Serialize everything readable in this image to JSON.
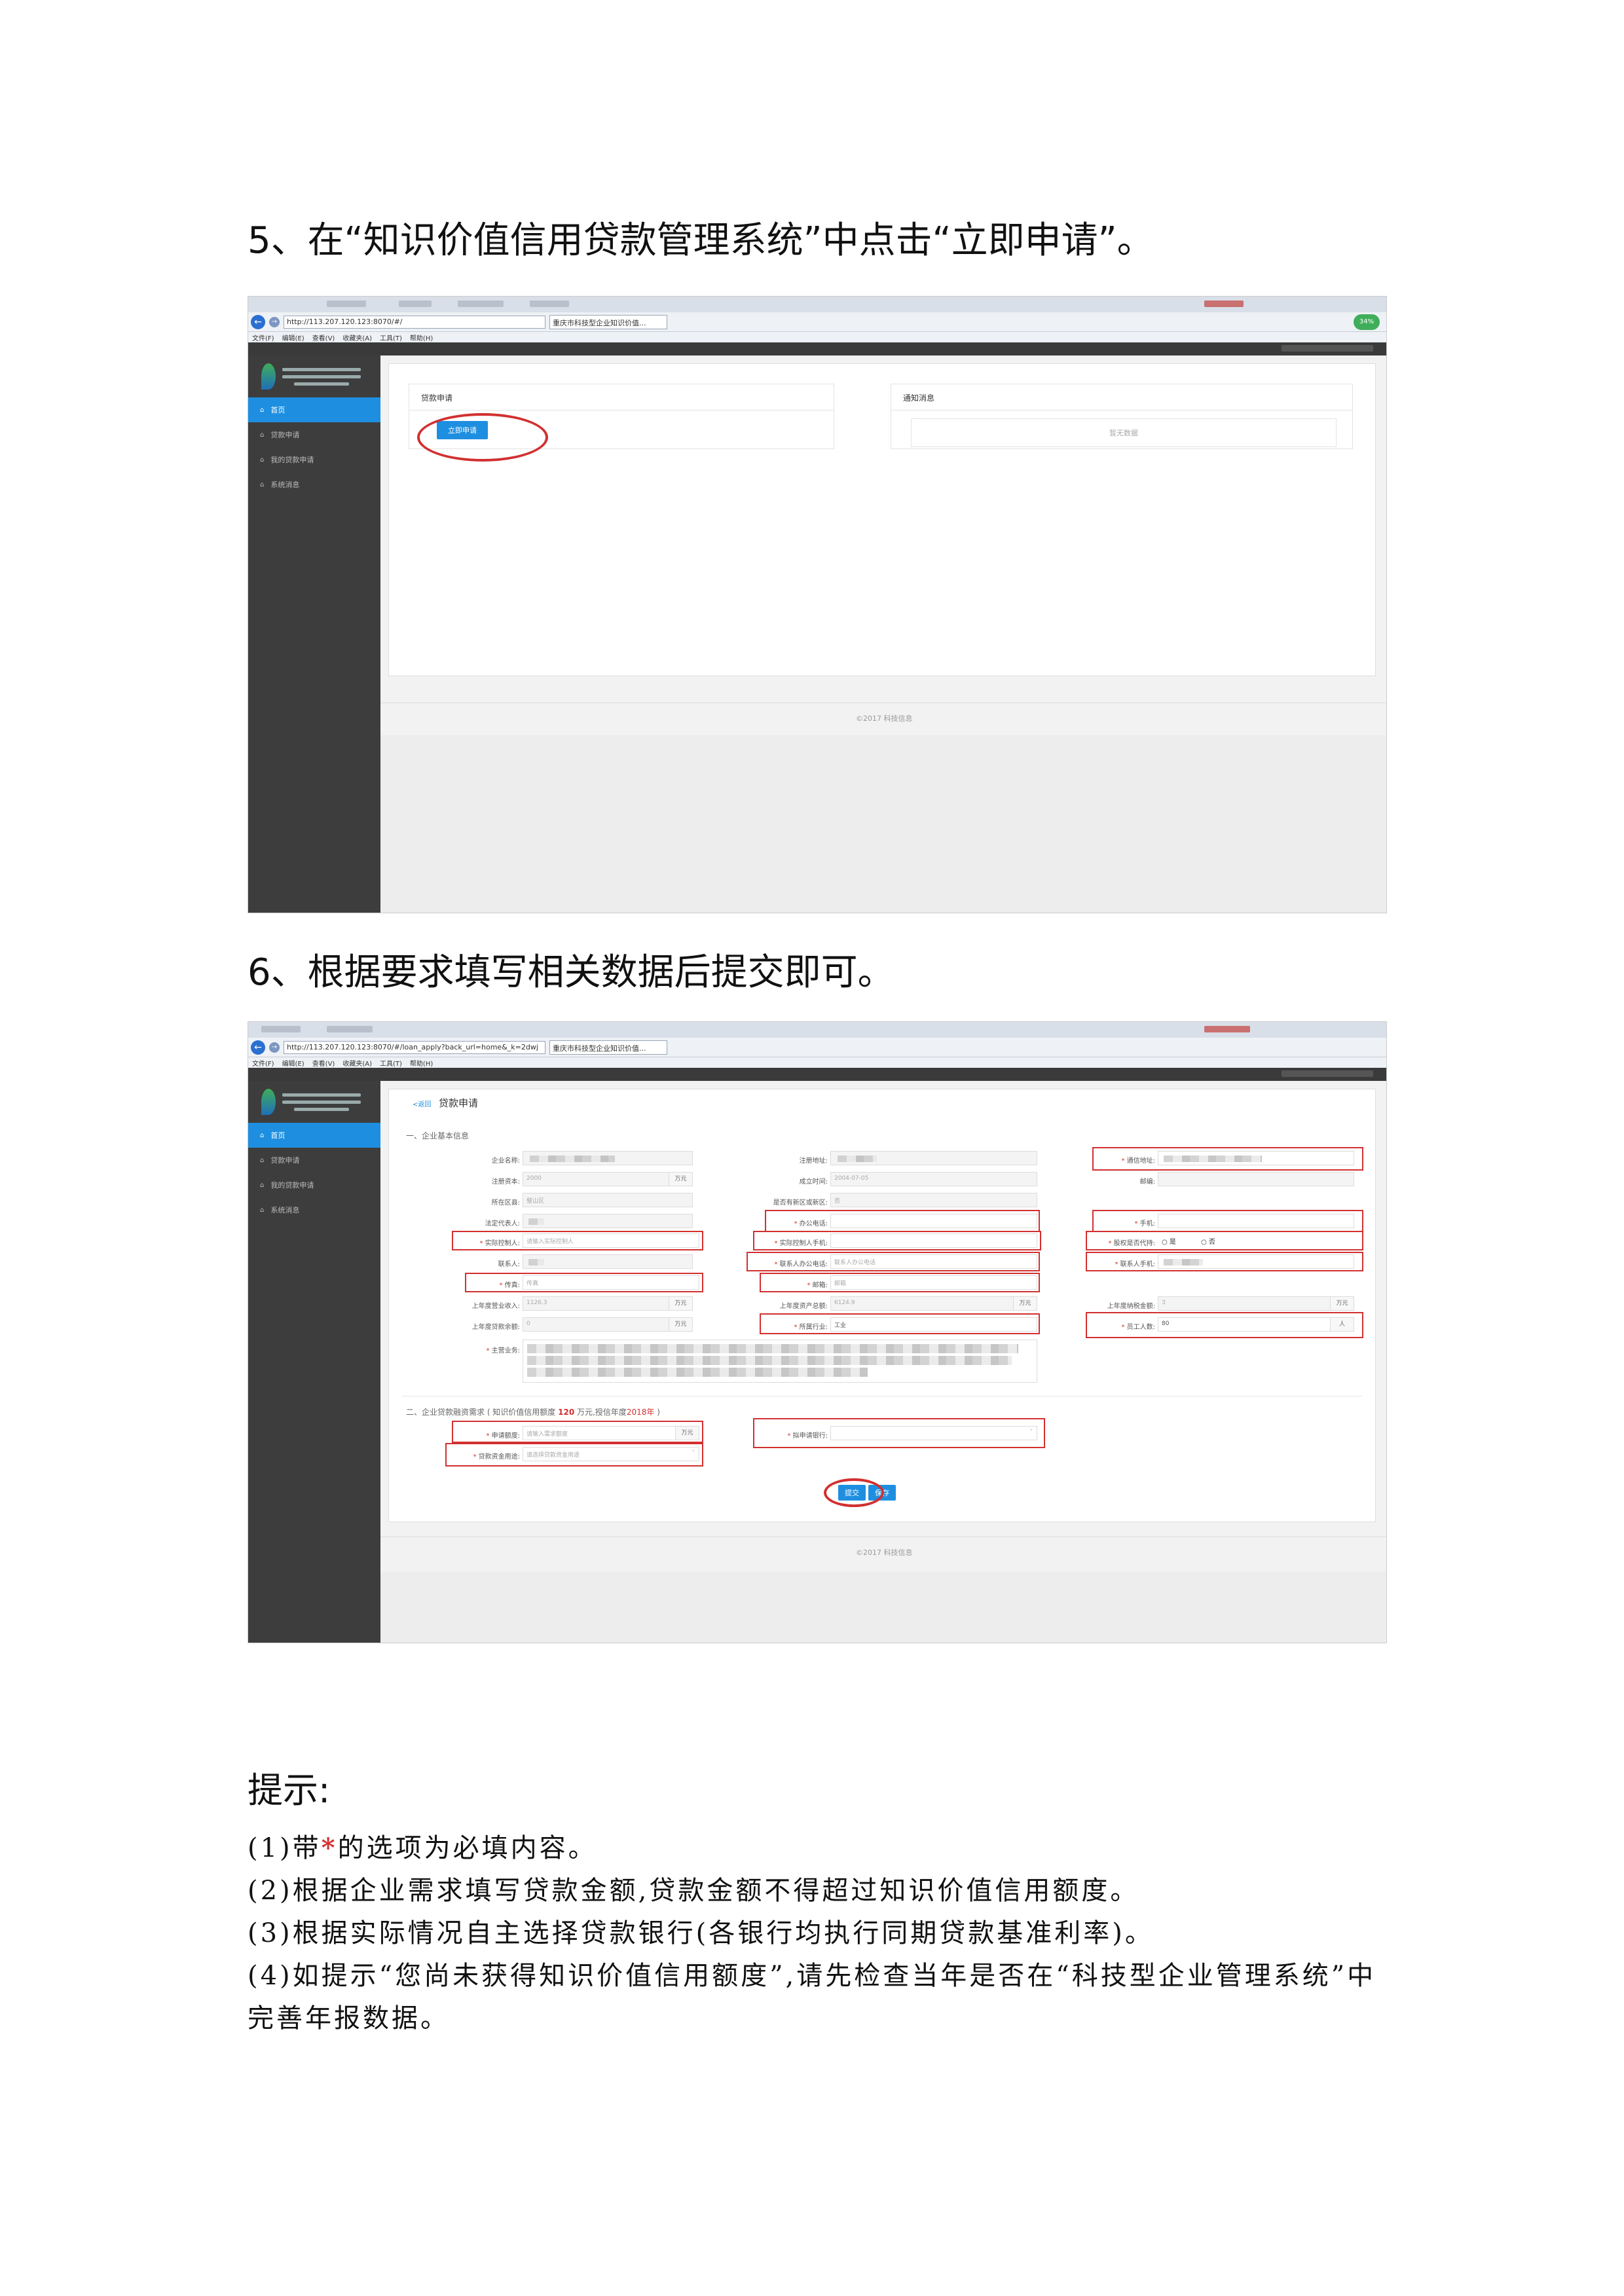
{
  "step5": "5、在“知识价值信用贷款管理系统”中点击“立即申请”。",
  "step6": "6、根据要求填写相关数据后提交即可。",
  "browser1": {
    "back_icon": "arrow-left-icon",
    "address": "http://113.207.120.123:8070/#/",
    "tab": "重庆市科技型企业知识价值...",
    "menu": [
      "文件(F)",
      "编辑(E)",
      "查看(V)",
      "收藏夹(A)",
      "工具(T)",
      "帮助(H)"
    ]
  },
  "browser2": {
    "address": "http://113.207.120.123:8070/#/loan_apply?back_url=home&_k=2dwj",
    "tab": "重庆市科技型企业知识价值...",
    "menu": [
      "文件(F)",
      "编辑(E)",
      "查看(V)",
      "收藏夹(A)",
      "工具(T)",
      "帮助(H)"
    ]
  },
  "sidebar": {
    "items": [
      "首页",
      "贷款申请",
      "我的贷款申请",
      "系统消息"
    ]
  },
  "home": {
    "loan_card_title": "贷款申请",
    "apply_button": "立即申请",
    "notice_card_title": "通知消息",
    "empty_text": "暂无数据",
    "footer": "©2017 科技信息"
  },
  "form": {
    "back_link": "<返回",
    "title": "贷款申请",
    "section1": "一、企业基本信息",
    "fields": {
      "company_name": "企业名称:",
      "reg_address": "注册地址:",
      "mail_address": "通信地址:",
      "reg_capital": "注册资本:",
      "reg_capital_value": "2000",
      "founded": "成立时间:",
      "founded_value": "2004-07-05",
      "postcode": "邮编:",
      "district": "所在区县:",
      "district_value": "璧山区",
      "high_tech_zone": "是否有新区或新区:",
      "high_tech_zone_value": "否",
      "legal_rep": "法定代表人:",
      "office_phone": "办公电话:",
      "mobile": "手机:",
      "controller": "实际控制人:",
      "controller_placeholder": "请输入实际控制人",
      "controller_mobile": "实际控制人手机:",
      "equity_pledge": "股权是否代持:",
      "equity_yes": "是",
      "equity_no": "否",
      "contact": "联系人:",
      "contact_office_phone": "联系人办公电话:",
      "contact_office_placeholder": "联系人办公电话",
      "contact_mobile": "联系人手机:",
      "fax": "传真:",
      "fax_value": "传真",
      "email": "邮箱:",
      "email_value": "邮箱",
      "last_revenue": "上年度营业收入:",
      "last_revenue_value": "1126.3",
      "last_assets": "上年度资产总额:",
      "last_assets_value": "6124.9",
      "last_tax": "上年度纳税金额:",
      "last_tax_value": "3",
      "last_loan": "上年度贷款余额:",
      "last_loan_value": "0",
      "industry": "所属行业:",
      "industry_value": "工业",
      "employees": "员工人数:",
      "employees_value": "80",
      "main_business": "主营业务:",
      "unit_wan": "万元",
      "unit_ren": "人"
    },
    "section2": "二、企业贷款融资需求 ( 知识价值信用额度",
    "section2_amount": "120",
    "section2_rest": "万元,授信年度",
    "section2_year": "2018年",
    "section2_close": " )",
    "apply_amount": "申请额度:",
    "apply_amount_placeholder": "请输入需求额度",
    "bank": "拟申请银行:",
    "purpose": "贷款资金用途:",
    "purpose_placeholder": "请选择贷款资金用途",
    "submit": "提交",
    "save": "保存",
    "footer": "©2017 科技信息"
  },
  "tips": {
    "heading": "提示:",
    "item1_prefix": "(1)带",
    "item1_star": "*",
    "item1_suffix": "的选项为必填内容。",
    "item2": "(2)根据企业需求填写贷款金额,贷款金额不得超过知识价值信用额度。",
    "item3": "(3)根据实际情况自主选择贷款银行(各银行均执行同期贷款基准利率)。",
    "item4": "(4)如提示“您尚未获得知识价值信用额度”,请先检查当年是否在“科技型企业管理系统”中完善年报数据。"
  }
}
